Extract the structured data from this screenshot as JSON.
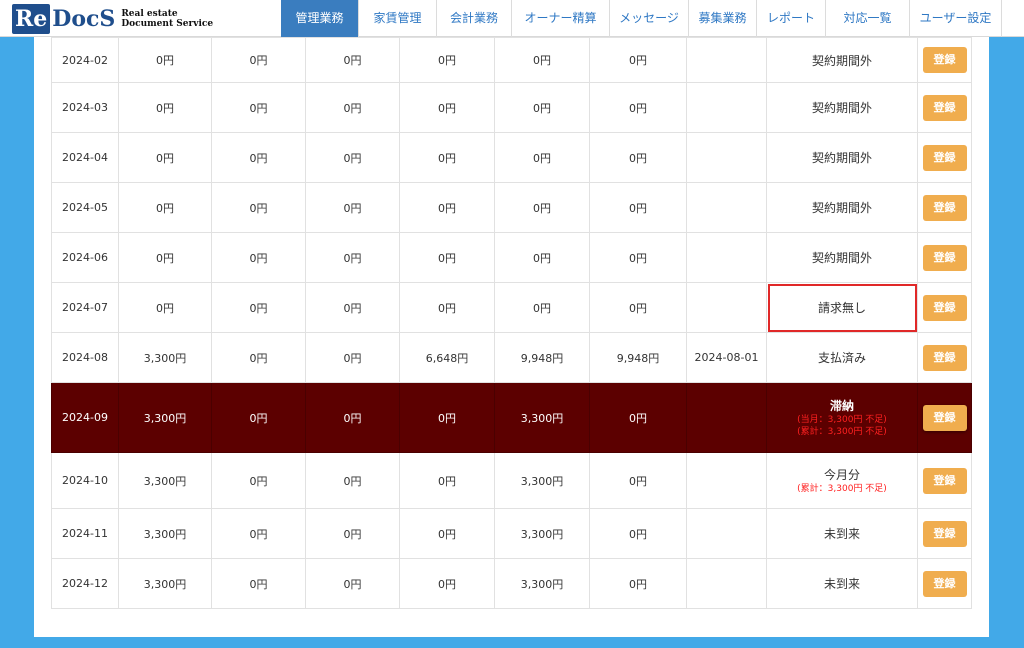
{
  "logo": {
    "re": "Re",
    "docs": "DocS",
    "tag_line1": "Real estate",
    "tag_line2": "Document Service"
  },
  "nav": [
    {
      "label": "管理業務",
      "active": true
    },
    {
      "label": "家賃管理"
    },
    {
      "label": "会計業務"
    },
    {
      "label": "オーナー精算"
    },
    {
      "label": "メッセージ"
    },
    {
      "label": "募集業務"
    },
    {
      "label": "レポート"
    },
    {
      "label": "対応一覧"
    },
    {
      "label": "ユーザー設定"
    }
  ],
  "register_label": "登録",
  "rows": [
    {
      "month": "2024-02",
      "c1": "0円",
      "c2": "0円",
      "c3": "0円",
      "c4": "0円",
      "c5": "0円",
      "c6": "0円",
      "date": "",
      "status": "契約期間外",
      "note1": "",
      "note2": ""
    },
    {
      "month": "2024-03",
      "c1": "0円",
      "c2": "0円",
      "c3": "0円",
      "c4": "0円",
      "c5": "0円",
      "c6": "0円",
      "date": "",
      "status": "契約期間外",
      "note1": "",
      "note2": ""
    },
    {
      "month": "2024-04",
      "c1": "0円",
      "c2": "0円",
      "c3": "0円",
      "c4": "0円",
      "c5": "0円",
      "c6": "0円",
      "date": "",
      "status": "契約期間外",
      "note1": "",
      "note2": ""
    },
    {
      "month": "2024-05",
      "c1": "0円",
      "c2": "0円",
      "c3": "0円",
      "c4": "0円",
      "c5": "0円",
      "c6": "0円",
      "date": "",
      "status": "契約期間外",
      "note1": "",
      "note2": ""
    },
    {
      "month": "2024-06",
      "c1": "0円",
      "c2": "0円",
      "c3": "0円",
      "c4": "0円",
      "c5": "0円",
      "c6": "0円",
      "date": "",
      "status": "契約期間外",
      "note1": "",
      "note2": ""
    },
    {
      "month": "2024-07",
      "c1": "0円",
      "c2": "0円",
      "c3": "0円",
      "c4": "0円",
      "c5": "0円",
      "c6": "0円",
      "date": "",
      "status": "請求無し",
      "note1": "",
      "note2": ""
    },
    {
      "month": "2024-08",
      "c1": "3,300円",
      "c2": "0円",
      "c3": "0円",
      "c4": "6,648円",
      "c5": "9,948円",
      "c6": "9,948円",
      "date": "2024-08-01",
      "status": "支払済み",
      "note1": "",
      "note2": ""
    },
    {
      "month": "2024-09",
      "c1": "3,300円",
      "c2": "0円",
      "c3": "0円",
      "c4": "0円",
      "c5": "3,300円",
      "c6": "0円",
      "date": "",
      "status": "滞納",
      "note1": "(当月：3,300円 不足)",
      "note2": "(累計：3,300円 不足)"
    },
    {
      "month": "2024-10",
      "c1": "3,300円",
      "c2": "0円",
      "c3": "0円",
      "c4": "0円",
      "c5": "3,300円",
      "c6": "0円",
      "date": "",
      "status": "今月分",
      "note1": "(累計：3,300円 不足)",
      "note2": ""
    },
    {
      "month": "2024-11",
      "c1": "3,300円",
      "c2": "0円",
      "c3": "0円",
      "c4": "0円",
      "c5": "3,300円",
      "c6": "0円",
      "date": "",
      "status": "未到来",
      "note1": "",
      "note2": ""
    },
    {
      "month": "2024-12",
      "c1": "3,300円",
      "c2": "0円",
      "c3": "0円",
      "c4": "0円",
      "c5": "3,300円",
      "c6": "0円",
      "date": "",
      "status": "未到来",
      "note1": "",
      "note2": ""
    }
  ],
  "colors": {
    "background": "#42a9e8",
    "nav_active": "#3a7dbf",
    "overdue_row": "#5c0000",
    "button": "#f0ad4e",
    "highlight_box": "#e02828",
    "shortage_text": "#ff2020"
  }
}
